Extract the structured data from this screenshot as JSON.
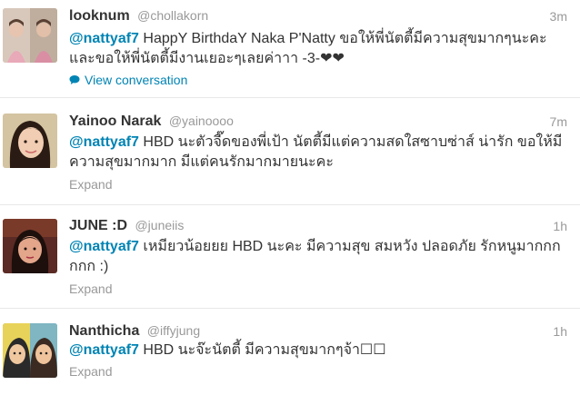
{
  "tweets": [
    {
      "fullname": "looknum",
      "username": "@chollakorn",
      "time": "3m",
      "mention": "@nattyaf7",
      "text": " HappY BirthdaY Naka P'Natty ขอให้พี่นัตตี้มีความสุขมากๆนะคะและขอให้พี่นัตตี้มีงานเยอะๆเลยค่าาา -3-❤❤",
      "action": "View conversation",
      "action_icon": "speech-bubble-icon"
    },
    {
      "fullname": "Yainoo Narak",
      "username": "@yainoooo",
      "time": "7m",
      "mention": "@nattyaf7",
      "text": " HBD นะตัวจี๊ดของพี่เป้า นัตตี้มีแต่ความสดใสซาบซ่าส์ น่ารัก ขอให้มีความสุขมากมาก มีแต่คนรักมากมายนะคะ",
      "action": "Expand"
    },
    {
      "fullname": "JUNE :D",
      "username": "@juneiis",
      "time": "1h",
      "mention": "@nattyaf7",
      "text": " เหมียวน้อยยย HBD นะคะ มีความสุข สมหวัง ปลอดภัย รักหนูมากกกกกก :)",
      "action": "Expand"
    },
    {
      "fullname": "Nanthicha",
      "username": "@iffyjung",
      "time": "1h",
      "mention": "@nattyaf7",
      "text": " HBD นะจ๊ะนัตตี้ มีความสุขมากๆจ้า☐☐",
      "action": "Expand"
    }
  ],
  "colors": {
    "link": "#0084b4",
    "muted": "#999999",
    "text": "#333333",
    "divider": "#e8e8e8"
  }
}
